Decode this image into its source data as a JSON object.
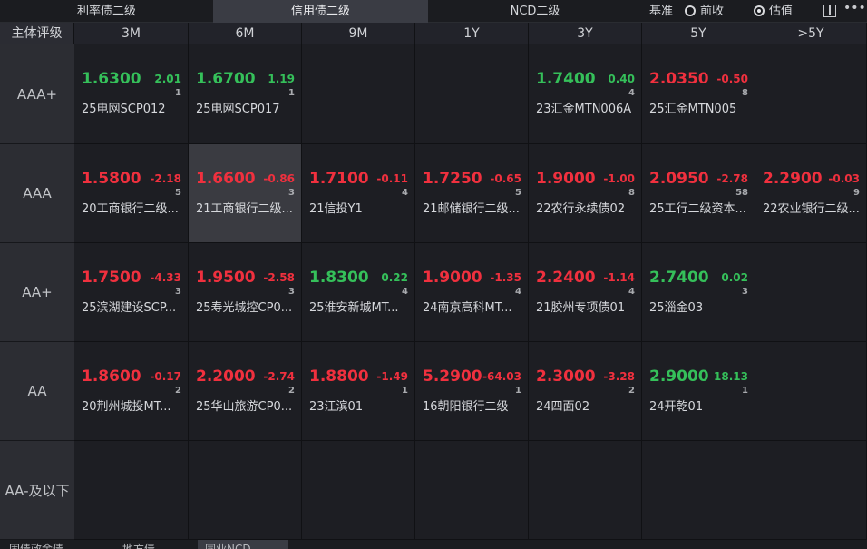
{
  "tabs": [
    "利率债二级",
    "信用债二级",
    "NCD二级"
  ],
  "active_tab": 1,
  "basis": {
    "label": "基准",
    "options": [
      "前收",
      "估值"
    ],
    "selected": 1
  },
  "header": {
    "first": "主体评级",
    "tenors": [
      "3M",
      "6M",
      "9M",
      "1Y",
      "3Y",
      "5Y",
      ">5Y"
    ]
  },
  "colors": {
    "up": "#f0303e",
    "down": "#35c05a"
  },
  "rows": [
    {
      "label": "AAA+",
      "cells": [
        {
          "rate": "1.6300",
          "change": "2.01",
          "count": "1",
          "name": "25电网SCP012",
          "color": "green"
        },
        {
          "rate": "1.6700",
          "change": "1.19",
          "count": "1",
          "name": "25电网SCP017",
          "color": "green"
        },
        null,
        null,
        {
          "rate": "1.7400",
          "change": "0.40",
          "count": "4",
          "name": "23汇金MTN006A",
          "color": "green"
        },
        {
          "rate": "2.0350",
          "change": "-0.50",
          "count": "8",
          "name": "25汇金MTN005",
          "color": "red"
        },
        null
      ]
    },
    {
      "label": "AAA",
      "cells": [
        {
          "rate": "1.5800",
          "change": "-2.18",
          "count": "5",
          "name": "20工商银行二级...",
          "color": "red"
        },
        {
          "rate": "1.6600",
          "change": "-0.86",
          "count": "3",
          "name": "21工商银行二级...",
          "color": "red",
          "highlight": true
        },
        {
          "rate": "1.7100",
          "change": "-0.11",
          "count": "4",
          "name": "21信投Y1",
          "color": "red"
        },
        {
          "rate": "1.7250",
          "change": "-0.65",
          "count": "5",
          "name": "21邮储银行二级...",
          "color": "red"
        },
        {
          "rate": "1.9000",
          "change": "-1.00",
          "count": "8",
          "name": "22农行永续债02",
          "color": "red"
        },
        {
          "rate": "2.0950",
          "change": "-2.78",
          "count": "58",
          "name": "25工行二级资本...",
          "color": "red"
        },
        {
          "rate": "2.2900",
          "change": "-0.03",
          "count": "9",
          "name": "22农业银行二级...",
          "color": "red"
        }
      ]
    },
    {
      "label": "AA+",
      "cells": [
        {
          "rate": "1.7500",
          "change": "-4.33",
          "count": "3",
          "name": "25滨湖建设SCP...",
          "color": "red"
        },
        {
          "rate": "1.9500",
          "change": "-2.58",
          "count": "3",
          "name": "25寿光城控CP0...",
          "color": "red"
        },
        {
          "rate": "1.8300",
          "change": "0.22",
          "count": "4",
          "name": "25淮安新城MT...",
          "color": "green"
        },
        {
          "rate": "1.9000",
          "change": "-1.35",
          "count": "4",
          "name": "24南京高科MT...",
          "color": "red"
        },
        {
          "rate": "2.2400",
          "change": "-1.14",
          "count": "4",
          "name": "21胶州专项债01",
          "color": "red"
        },
        {
          "rate": "2.7400",
          "change": "0.02",
          "count": "3",
          "name": "25淄金03",
          "color": "green"
        },
        null
      ]
    },
    {
      "label": "AA",
      "cells": [
        {
          "rate": "1.8600",
          "change": "-0.17",
          "count": "2",
          "name": "20荆州城投MT...",
          "color": "red"
        },
        {
          "rate": "2.2000",
          "change": "-2.74",
          "count": "2",
          "name": "25华山旅游CP0...",
          "color": "red"
        },
        {
          "rate": "1.8800",
          "change": "-1.49",
          "count": "1",
          "name": "23江滨01",
          "color": "red"
        },
        {
          "rate": "5.2900",
          "change": "-64.03",
          "count": "1",
          "name": "16朝阳银行二级",
          "color": "red"
        },
        {
          "rate": "2.3000",
          "change": "-3.28",
          "count": "2",
          "name": "24四面02",
          "color": "red"
        },
        {
          "rate": "2.9000",
          "change": "18.13",
          "count": "1",
          "name": "24开乾01",
          "color": "green"
        },
        null
      ]
    },
    {
      "label": "AA-及以下",
      "cells": [
        null,
        null,
        null,
        null,
        null,
        null,
        null
      ]
    }
  ],
  "bottom_tabs": [
    "固债政金债",
    "地方债",
    "同业NCD"
  ]
}
